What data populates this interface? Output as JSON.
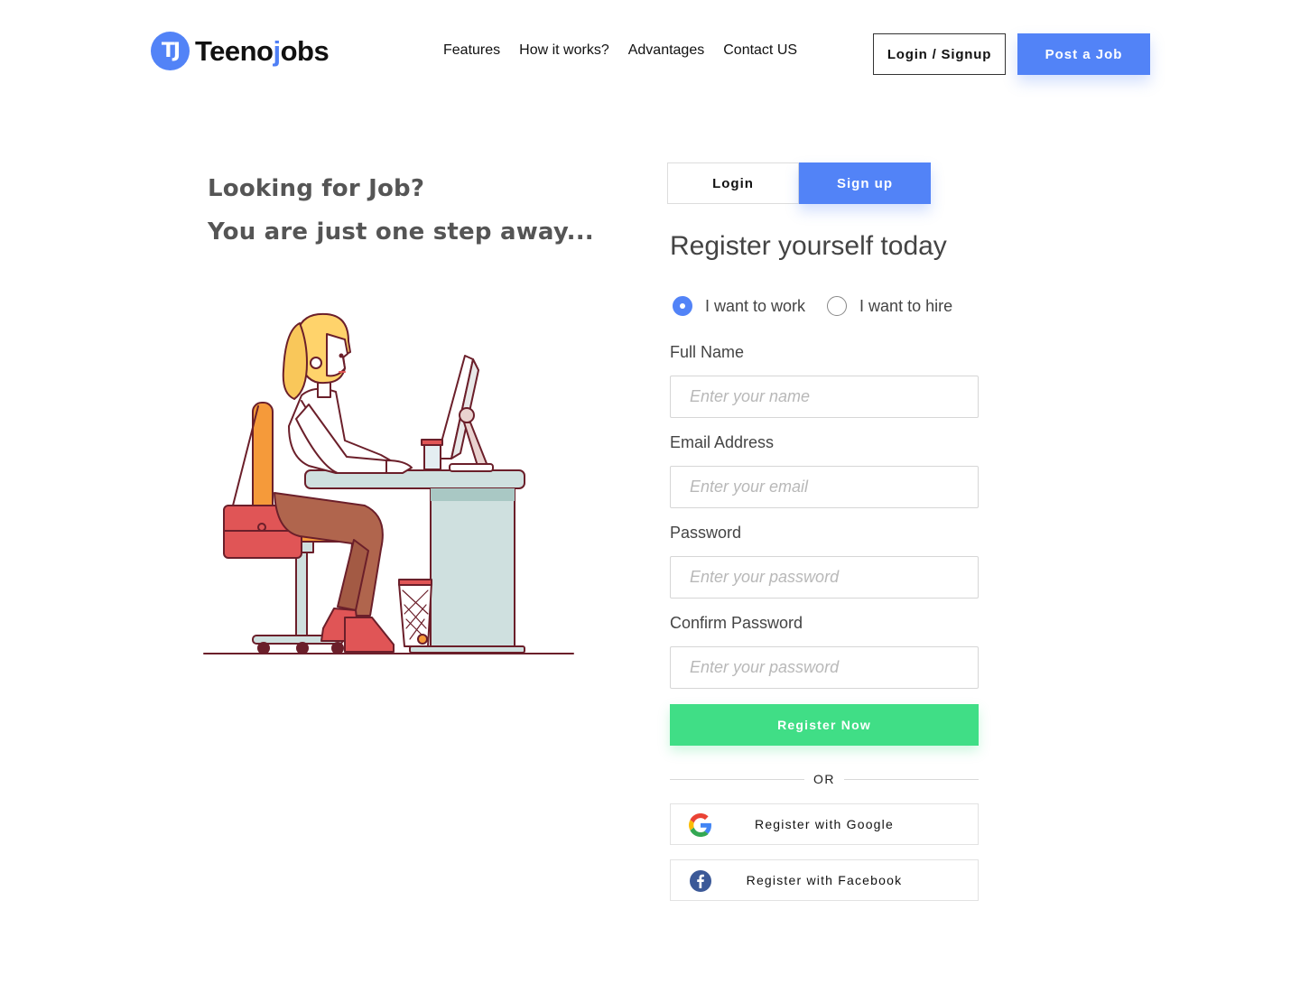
{
  "header": {
    "logo_badge": "TJ",
    "logo_text_start": "Teeno",
    "logo_text_accent": "j",
    "logo_text_end": "obs",
    "nav": [
      "Features",
      "How it works?",
      "Advantages",
      "Contact US"
    ],
    "login_signup_label": "Login / Signup",
    "post_job_label": "Post a Job"
  },
  "hero": {
    "line1": "Looking for Job?",
    "line2": "You are just one step away..."
  },
  "form": {
    "tabs": {
      "login": "Login",
      "signup": "Sign up",
      "active": "signup"
    },
    "title": "Register yourself today",
    "radio": {
      "options": [
        "I want to work",
        "I want to hire"
      ],
      "selected": "I want to work"
    },
    "fields": [
      {
        "label": "Full Name",
        "placeholder": "Enter your name",
        "value": ""
      },
      {
        "label": "Email Address",
        "placeholder": "Enter your email",
        "value": ""
      },
      {
        "label": "Password",
        "placeholder": "Enter your password",
        "value": ""
      },
      {
        "label": "Confirm Password",
        "placeholder": "Enter your password",
        "value": ""
      }
    ],
    "register_label": "Register Now",
    "or_label": "OR",
    "google_label": "Register with Google",
    "facebook_label": "Register with Facebook"
  },
  "colors": {
    "primary": "#5283f7",
    "success": "#40de86",
    "heading": "#555555"
  }
}
